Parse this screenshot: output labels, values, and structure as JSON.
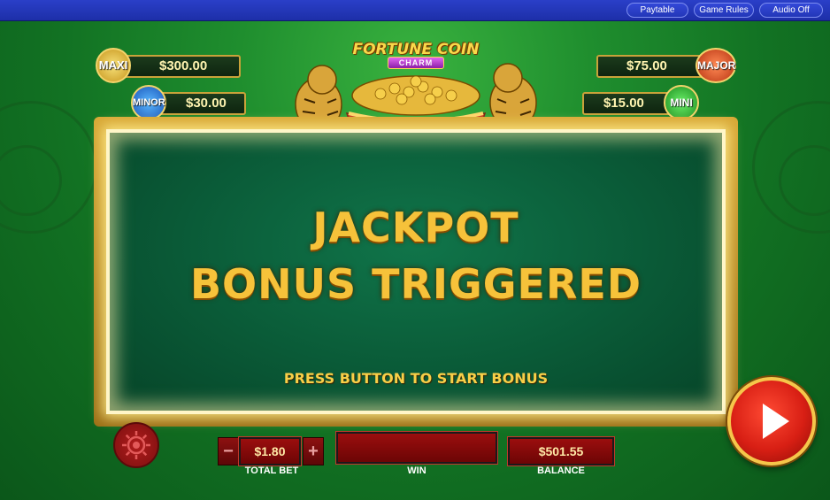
{
  "topbar": {
    "buttons": [
      "Paytable",
      "Game Rules",
      "Audio Off"
    ]
  },
  "logo": {
    "title": "FORTUNE COIN",
    "subtitle": "CHARM"
  },
  "jackpots": {
    "maxi": {
      "label": "MAXI",
      "amount": "$300.00"
    },
    "minor": {
      "label": "MINOR",
      "amount": "$30.00"
    },
    "major": {
      "label": "MAJOR",
      "amount": "$75.00"
    },
    "mini": {
      "label": "MINI",
      "amount": "$15.00"
    }
  },
  "message": {
    "line1": "JACKPOT",
    "line2": "BONUS TRIGGERED",
    "prompt": "PRESS BUTTON TO START BONUS"
  },
  "controls": {
    "total_bet": "$1.80",
    "total_bet_label": "TOTAL BET",
    "win": "",
    "win_label": "WIN",
    "balance": "$501.55",
    "balance_label": "BALANCE",
    "minus": "−",
    "plus": "+"
  },
  "colors": {
    "topbar": "#2237b8",
    "background": "#127223",
    "frame_gold": "#d8a836",
    "panel_green": "#0a5a37",
    "headline": "#f6c23a",
    "control_red": "#8d1111",
    "play_red": "#d81f14"
  }
}
